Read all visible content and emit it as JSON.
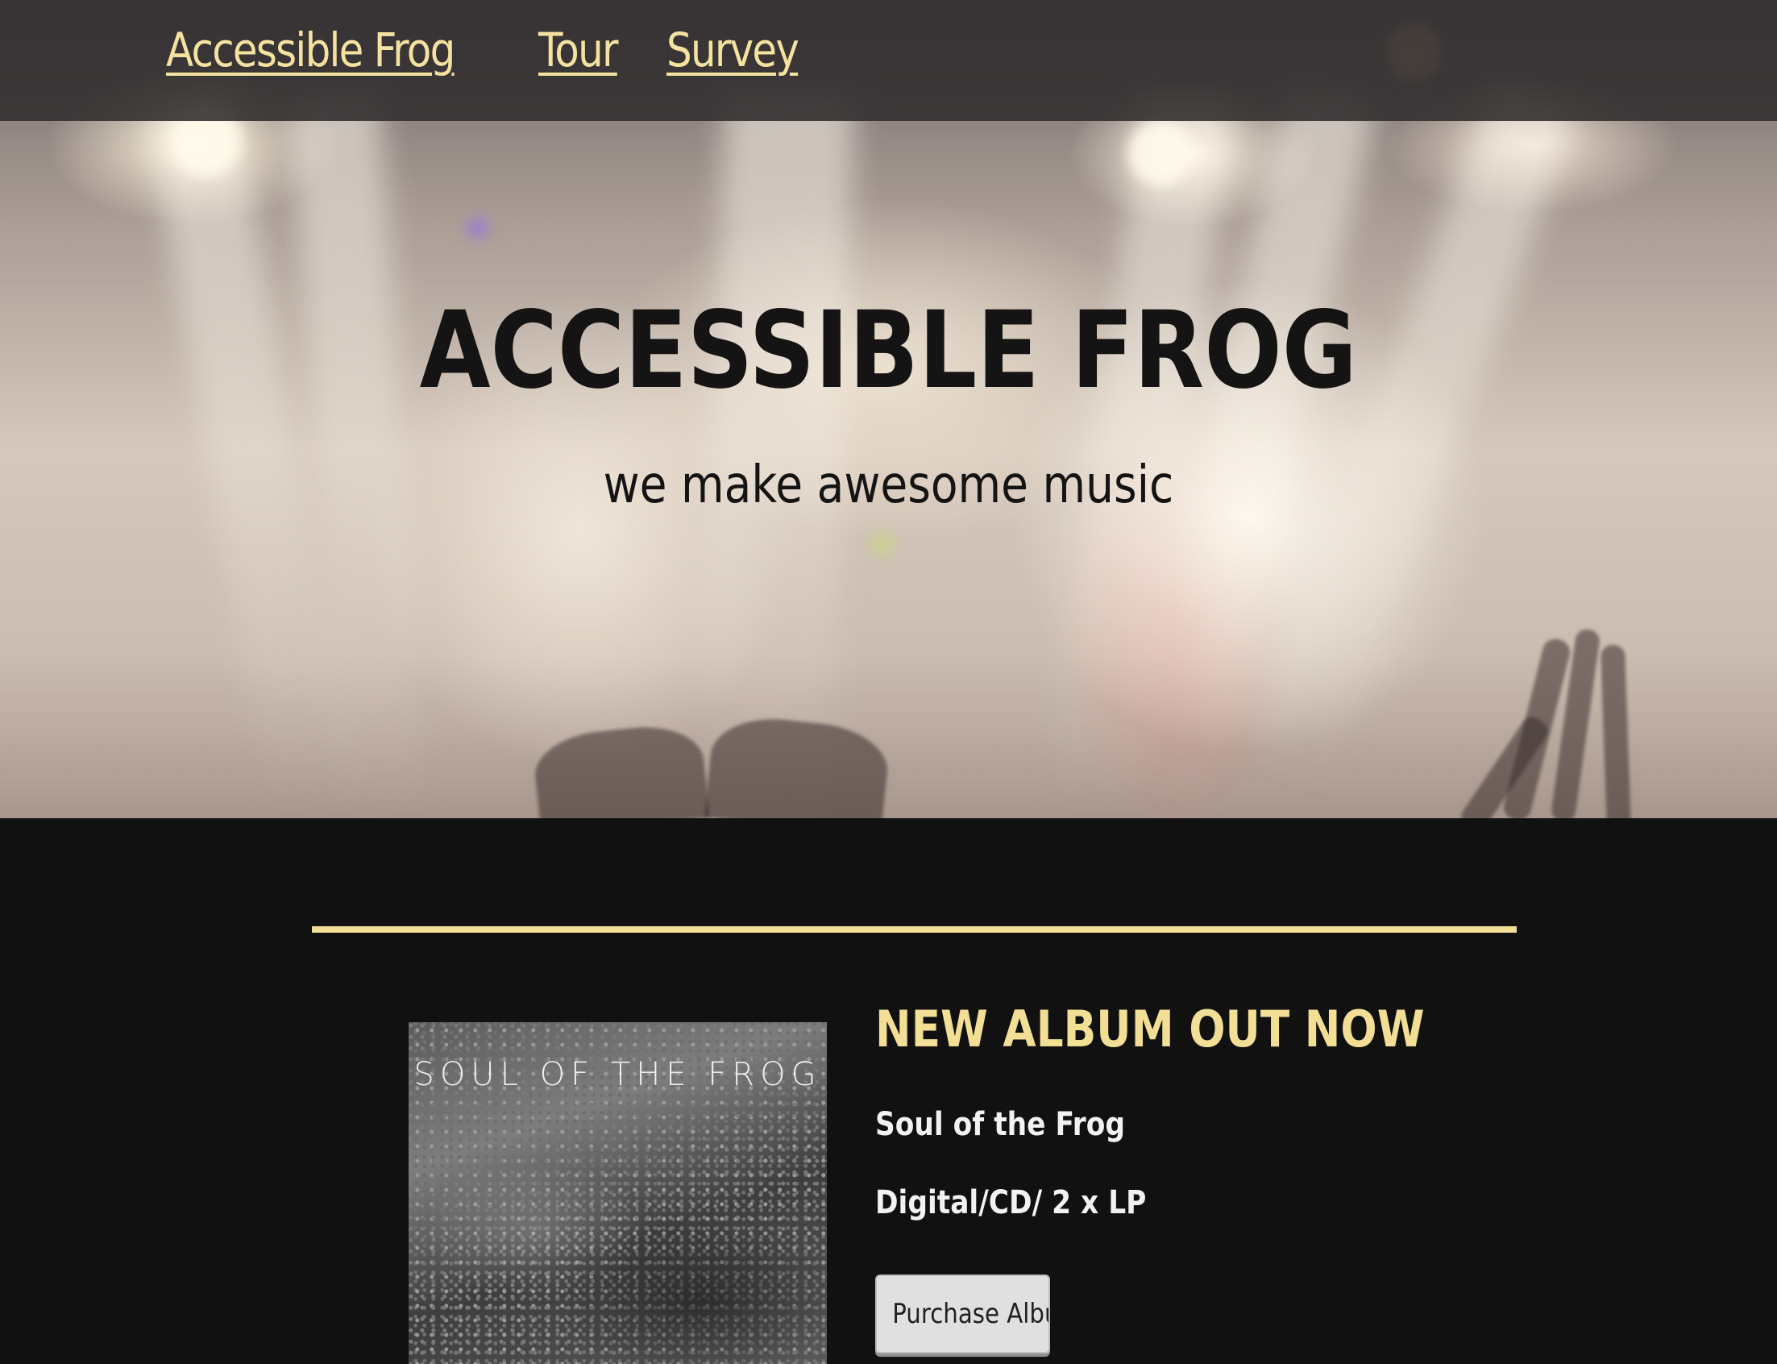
{
  "nav": {
    "items": [
      {
        "label": "Accessible Frog"
      },
      {
        "label": "Tour"
      },
      {
        "label": "Survey"
      }
    ]
  },
  "hero": {
    "title": "ACCESSIBLE FROG",
    "subtitle": "we make awesome music"
  },
  "album": {
    "cover_title": "SOUL OF THE FROG",
    "heading": "NEW ALBUM OUT NOW",
    "name": "Soul of the Frog",
    "formats": "Digital/CD/ 2 x LP",
    "purchase_label": "Purchase Album"
  },
  "colors": {
    "accent": "#f2de95",
    "nav_link": "#f4e2a0",
    "page_background": "#111111"
  }
}
